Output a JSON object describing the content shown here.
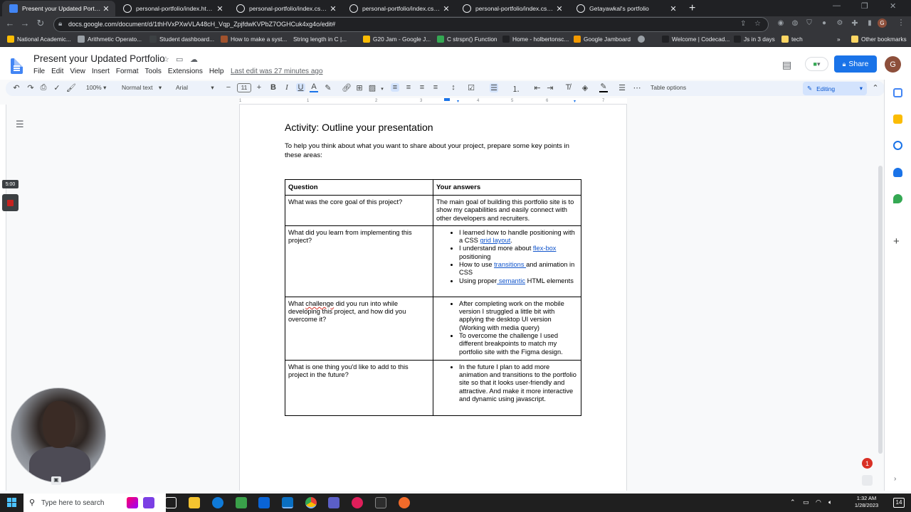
{
  "browser": {
    "tabs": [
      {
        "title": "Present your Updated Portfolio",
        "active": true,
        "icon": "google-docs-icon"
      },
      {
        "title": "personal-portfolio/index.html at",
        "active": false,
        "icon": "github-icon"
      },
      {
        "title": "personal-portfolio/index.css at m",
        "active": false,
        "icon": "github-icon"
      },
      {
        "title": "personal-portfolio/index.css at m",
        "active": false,
        "icon": "github-icon"
      },
      {
        "title": "personal-portfolio/index.css at m",
        "active": false,
        "icon": "github-icon"
      },
      {
        "title": "Getayawkal's portfolio",
        "active": false,
        "icon": "globe-icon"
      }
    ],
    "url": "docs.google.com/document/d/1thHVxPXwVLA48cH_Vqp_ZpjfdwKVPbZ7OGHCuk4xg4o/edit#",
    "bookmarks": [
      "National Academic...",
      "Arithmetic Operato...",
      "Student dashboard...",
      "How to make a syst...",
      "String length in C |...",
      "G20 Jam - Google J...",
      "C strspn() Function",
      "Home - holbertonsc...",
      "Google Jamboard",
      "Welcome | Codecad...",
      "Js in 3 days",
      "tech"
    ],
    "other_bookmarks": "Other bookmarks"
  },
  "docs": {
    "title": "Present your Updated Portfolio",
    "menu": [
      "File",
      "Edit",
      "View",
      "Insert",
      "Format",
      "Tools",
      "Extensions",
      "Help"
    ],
    "last_edit": "Last edit was 27 minutes ago",
    "share_label": "Share",
    "avatar_initial": "G",
    "toolbar": {
      "zoom": "100%",
      "style": "Normal text",
      "font": "Arial",
      "font_size": "11",
      "table_options": "Table options",
      "mode": "Editing"
    },
    "ruler_numbers": [
      "1",
      "1",
      "2",
      "3",
      "4",
      "5",
      "6",
      "7"
    ]
  },
  "document": {
    "heading": "Activity: Outline your presentation",
    "intro": "To help you think about what you want to share about your project, prepare some key points in these areas:",
    "table": {
      "headers": [
        "Question",
        "Your answers"
      ],
      "rows": [
        {
          "question": "What was the core goal of this project?",
          "answer_text": " The main goal of building this portfolio site is to show my capabilities and easily connect with other developers and recruiters."
        },
        {
          "question": "What did you learn from implementing this project?",
          "bullets": [
            {
              "a": "I learned how to handle positioning with a CSS ",
              "link": "grid layout",
              "b": "."
            },
            {
              "a": "I understand more about ",
              "link": "flex-box",
              "b": " positioning"
            },
            {
              "a": "How to use ",
              "link": "transitions ",
              "b": "and animation in CSS"
            },
            {
              "a": "Using proper",
              "link": " semantic",
              "b": " HTML elements"
            }
          ]
        },
        {
          "question_a": "What ",
          "question_spell": "challenge",
          "question_b": " did you run into while developing this project, and how did you overcome it?",
          "bullets_text": [
            "After completing work on the mobile version I struggled a little bit with applying the desktop UI version (Working with media query)",
            "To overcome the challenge I used different breakpoints to match my portfolio site with the Figma design."
          ]
        },
        {
          "question": "What is one thing you'd like to add to this project in the future?",
          "bullets_text": [
            "In the future I plan to add more animation and transitions to the portfolio site so that it looks user-friendly and attractive. And make it more interactive and dynamic using javascript."
          ]
        }
      ]
    }
  },
  "overlay": {
    "timer": "5:00",
    "notification_count": "1"
  },
  "taskbar": {
    "search_placeholder": "Type here to search",
    "time": "1:32 AM",
    "date": "1/28/2023",
    "notifications": "14"
  }
}
